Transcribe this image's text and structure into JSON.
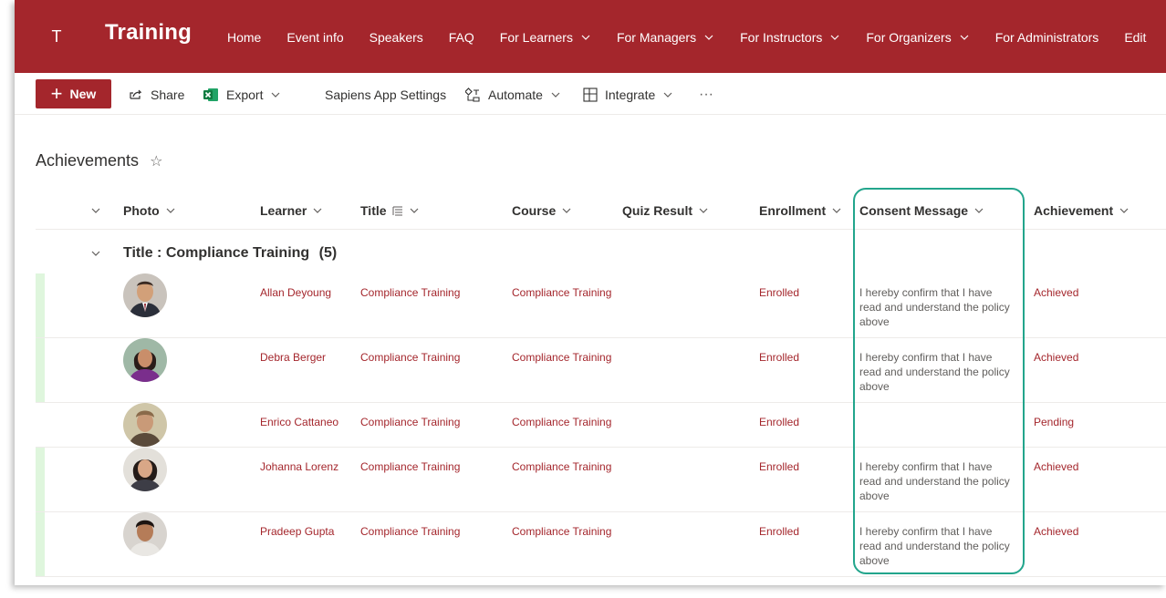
{
  "site": {
    "logo_letter": "T",
    "title": "Training",
    "nav": [
      {
        "label": "Home",
        "has_chevron": false
      },
      {
        "label": "Event info",
        "has_chevron": false
      },
      {
        "label": "Speakers",
        "has_chevron": false
      },
      {
        "label": "FAQ",
        "has_chevron": false
      },
      {
        "label": "For Learners",
        "has_chevron": true
      },
      {
        "label": "For Managers",
        "has_chevron": true
      },
      {
        "label": "For Instructors",
        "has_chevron": true
      },
      {
        "label": "For Organizers",
        "has_chevron": true
      },
      {
        "label": "For Administrators",
        "has_chevron": false
      },
      {
        "label": "Edit",
        "has_chevron": false
      }
    ]
  },
  "commandbar": {
    "new_label": "New",
    "share_label": "Share",
    "export_label": "Export",
    "sapiens_label": "Sapiens App Settings",
    "automate_label": "Automate",
    "integrate_label": "Integrate",
    "more_label": "···"
  },
  "page": {
    "title": "Achievements",
    "favorite_glyph": "☆"
  },
  "list": {
    "columns": {
      "photo": "Photo",
      "learner": "Learner",
      "title": "Title",
      "course": "Course",
      "quiz": "Quiz Result",
      "enrollment": "Enrollment",
      "consent": "Consent Message",
      "achievement": "Achievement"
    },
    "group": {
      "label": "Title : Compliance Training",
      "count": "(5)"
    },
    "rows": [
      {
        "learner": "Allan Deyoung",
        "title": "Compliance Training",
        "course": "Compliance Training",
        "quiz": "",
        "enrollment": "Enrolled",
        "consent": "I hereby confirm that I have read and understand the policy above",
        "achievement": "Achieved"
      },
      {
        "learner": "Debra Berger",
        "title": "Compliance Training",
        "course": "Compliance Training",
        "quiz": "",
        "enrollment": "Enrolled",
        "consent": "I hereby confirm that I have read and understand the policy above",
        "achievement": "Achieved"
      },
      {
        "learner": "Enrico Cattaneo",
        "title": "Compliance Training",
        "course": "Compliance Training",
        "quiz": "",
        "enrollment": "Enrolled",
        "consent": "",
        "achievement": "Pending"
      },
      {
        "learner": "Johanna Lorenz",
        "title": "Compliance Training",
        "course": "Compliance Training",
        "quiz": "",
        "enrollment": "Enrolled",
        "consent": "I hereby confirm that I have read and understand the policy above",
        "achievement": "Achieved"
      },
      {
        "learner": "Pradeep Gupta",
        "title": "Compliance Training",
        "course": "Compliance Training",
        "quiz": "",
        "enrollment": "Enrolled",
        "consent": "I hereby confirm that I have read and understand the policy above",
        "achievement": "Achieved"
      }
    ]
  },
  "colors": {
    "brand": "#a4262c",
    "highlight": "#22a58c",
    "row_marker": "#dff6dd"
  }
}
